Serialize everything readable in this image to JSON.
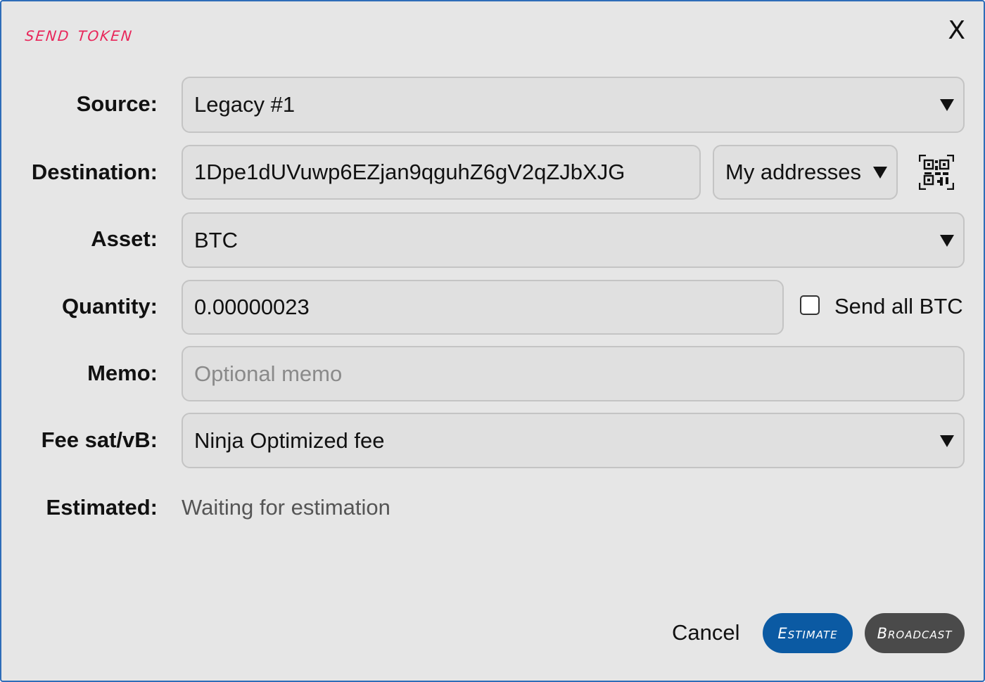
{
  "dialog": {
    "title": "Send token",
    "close_label": "X"
  },
  "form": {
    "source": {
      "label": "Source:",
      "value": "Legacy #1"
    },
    "destination": {
      "label": "Destination:",
      "value": "1Dpe1dUVuwp6EZjan9qguhZ6gV2qZJbXJG",
      "address_picker": "My addresses",
      "qr_icon": "qr-code-icon"
    },
    "asset": {
      "label": "Asset:",
      "value": "BTC"
    },
    "quantity": {
      "label": "Quantity:",
      "value": "0.00000023",
      "send_all_label": "Send all BTC",
      "send_all_checked": false
    },
    "memo": {
      "label": "Memo:",
      "value": "",
      "placeholder": "Optional memo"
    },
    "fee": {
      "label": "Fee sat/vB:",
      "value": "Ninja Optimized fee"
    },
    "estimated": {
      "label": "Estimated:",
      "value": "Waiting for estimation"
    }
  },
  "actions": {
    "cancel_label": "Cancel",
    "estimate_label": "Estimate",
    "broadcast_label": "Broadcast"
  },
  "colors": {
    "title": "#e8265a",
    "estimate_button": "#0b5aa3",
    "broadcast_button": "#4a4a4a",
    "dialog_border": "#2e6cb8"
  }
}
